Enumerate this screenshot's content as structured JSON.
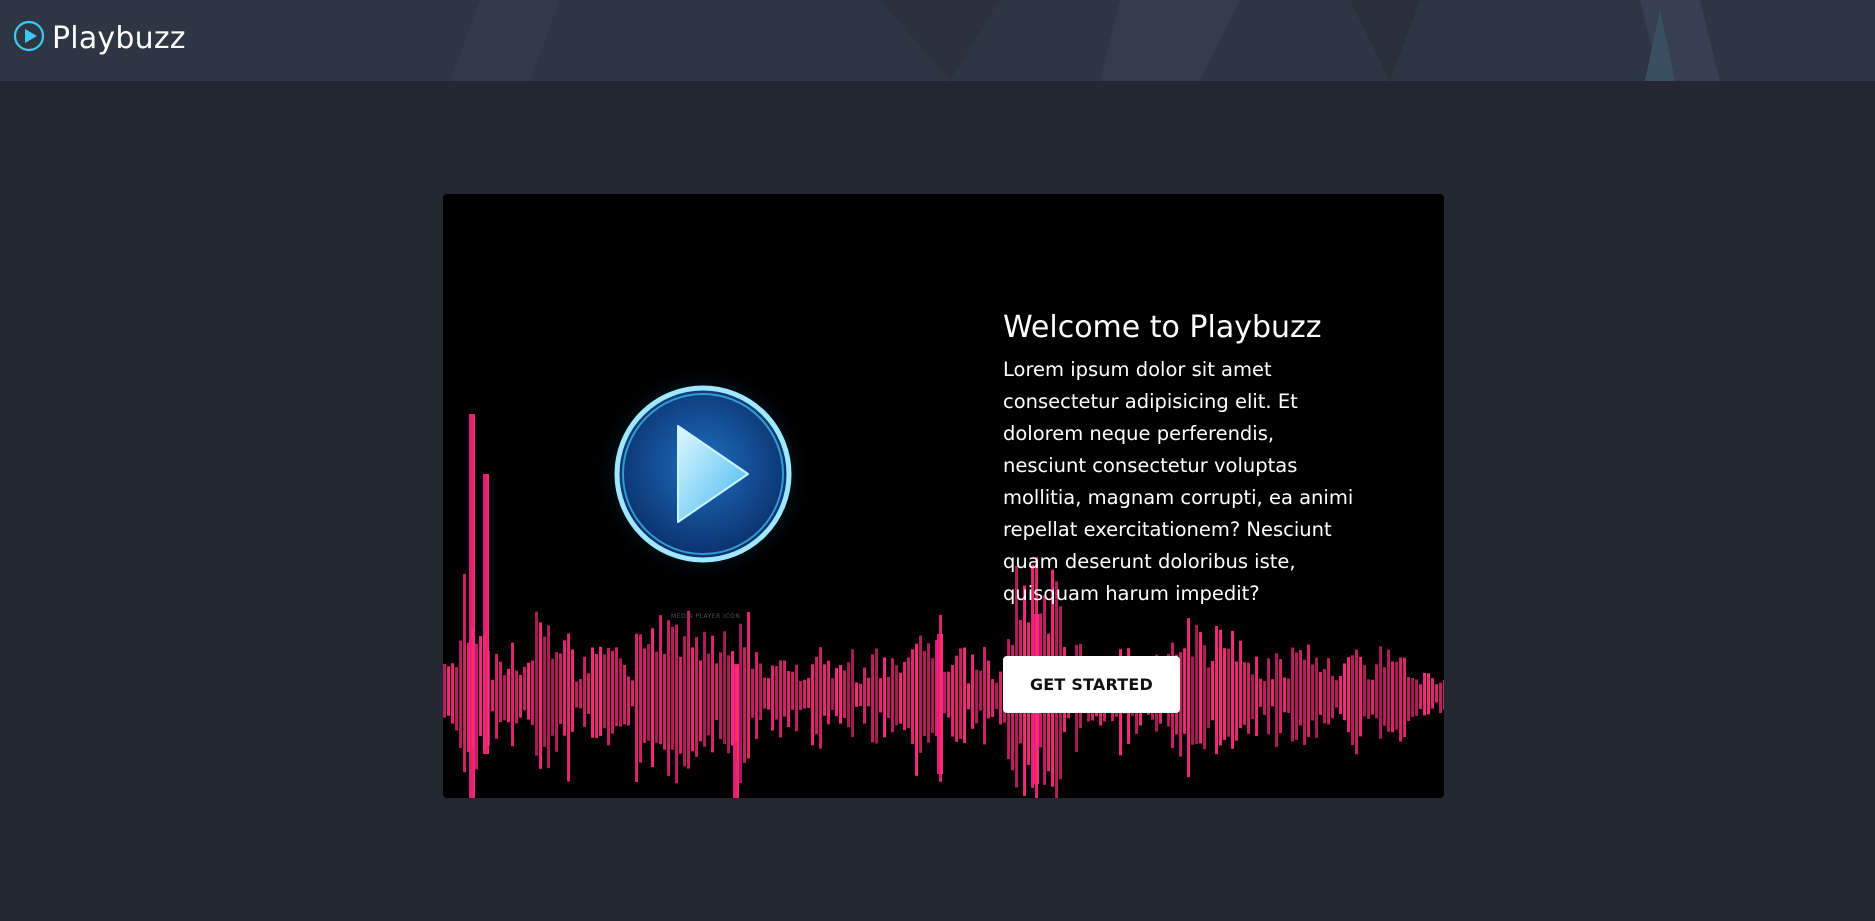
{
  "header": {
    "brand_name": "Playbuzz",
    "logo_icon": "play-circle-icon"
  },
  "hero": {
    "title": "Welcome to Playbuzz",
    "description": "Lorem ipsum dolor sit amet consectetur adipisicing elit. Et dolorem neque perferendis, nesciunt consectetur voluptas mollitia, magnam corrupti, ea animi repellat exercitationem? Nesciunt quam deserunt doloribus iste, quisquam harum impedit?",
    "cta_label": "GET STARTED",
    "image_credit": "MEDIA PLAYER ICON",
    "image_icon": "glowing-play-button-icon"
  },
  "colors": {
    "page_background": "#222731",
    "header_background": "#2e3643",
    "card_background": "#000000",
    "accent_blue": "#3fc8f5",
    "wave_pink": "#ff1aa8",
    "wave_red": "#ff3a4a",
    "button_background": "#ffffff"
  }
}
